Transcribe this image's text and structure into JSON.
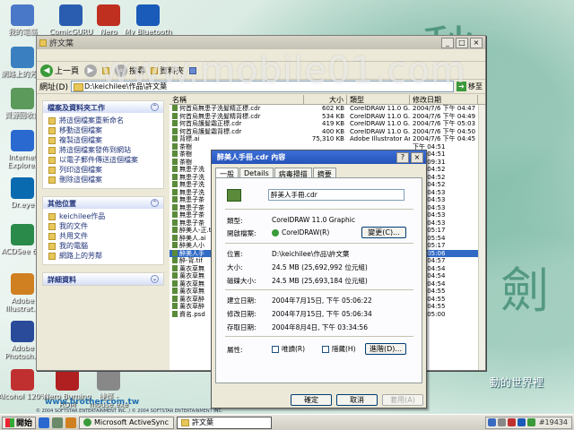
{
  "watermark": "www.mobile01.com",
  "banner": "www.brother.com.tw",
  "banner_small": "© 2004 SOFTSTAR ENTERTAINMENT INC. / © 2004 SOFTSTAR ENTERTAINMENT INC.",
  "slogan": "動的世界裡",
  "decor": {
    "glyph1": "愁",
    "glyph2": "劍"
  },
  "desktop_icons": [
    {
      "label": "我的電腦",
      "color": "#4a78c8"
    },
    {
      "label": "ComicGURU Converter",
      "color": "#2a5db0"
    },
    {
      "label": "Nero StartSmart",
      "color": "#c03020"
    },
    {
      "label": "My Bluetooth Places",
      "color": "#1a5ab8"
    },
    {
      "label": "網路上的芳鄰",
      "color": "#3a80c0"
    },
    {
      "label": "資源回收筒",
      "color": "#5b9a5b"
    },
    {
      "label": "Internet Explorer",
      "color": "#2a6ad0"
    },
    {
      "label": "Dr.eye",
      "color": "#0a6ab0"
    },
    {
      "label": "ACDSee 6.0",
      "color": "#2a8a4a"
    },
    {
      "label": "Adobe Illustrat...",
      "color": "#d08020"
    },
    {
      "label": "Adobe Photosh...",
      "color": "#2a4a9a"
    },
    {
      "label": "Alcohol 120%",
      "color": "#c03030"
    },
    {
      "label": "Nero Burning ROM",
      "color": "#b02020"
    },
    {
      "label": "捷徑 - mouse.exe",
      "color": "#888888"
    }
  ],
  "explorer": {
    "title": "許文葉",
    "toolbar": {
      "back": "上一頁",
      "search": "搜尋",
      "folders": "資料夾"
    },
    "address_label": "網址(D)",
    "address_value": "D:\\keichilee\\作品\\許文葉",
    "go_label": "移至",
    "panels": [
      {
        "title": "檔案及資料夾工作",
        "items": [
          "將這個檔案重新命名",
          "移動這個檔案",
          "複製這個檔案",
          "將這個檔案發佈到網站",
          "以電子郵件傳送這個檔案",
          "列印這個檔案",
          "刪除這個檔案"
        ]
      },
      {
        "title": "其他位置",
        "items": [
          "keichilee作品",
          "我的文件",
          "共用文件",
          "我的電腦",
          "網路上的芳鄰"
        ]
      },
      {
        "title": "詳細資料",
        "items": []
      }
    ],
    "columns": [
      "名稱",
      "大小",
      "類型",
      "修改日期"
    ],
    "files": [
      {
        "name": "何首烏無患子洗髮精正標.cdr",
        "size": "602 KB",
        "type": "CorelDRAW 11.0 G...",
        "date": "2004/7/6 下午 04:47"
      },
      {
        "name": "何首烏無患子洗髮精背標.cdr",
        "size": "534 KB",
        "type": "CorelDRAW 11.0 G...",
        "date": "2004/7/6 下午 04:49"
      },
      {
        "name": "何首烏護髮霜正標.cdr",
        "size": "419 KB",
        "type": "CorelDRAW 11.0 G...",
        "date": "2004/7/6 下午 05:03"
      },
      {
        "name": "何首烏護髮霜背標.cdr",
        "size": "400 KB",
        "type": "CorelDRAW 11.0 G...",
        "date": "2004/7/6 下午 04:50"
      },
      {
        "name": "背標.ai",
        "size": "75,310 KB",
        "type": "Adobe Illustrator Art...",
        "date": "2004/7/6 下午 04:45"
      },
      {
        "name": "茶樹",
        "size": "",
        "type": "",
        "date": "下午 04:51"
      },
      {
        "name": "茶樹",
        "size": "",
        "type": "",
        "date": "下午 04:51"
      },
      {
        "name": "茶樹",
        "size": "",
        "type": "",
        "date": "下午 09:31"
      },
      {
        "name": "無患子洗",
        "size": "",
        "type": "",
        "date": "下午 04:52"
      },
      {
        "name": "無患子洗",
        "size": "",
        "type": "",
        "date": "下午 04:52"
      },
      {
        "name": "無患子洗",
        "size": "",
        "type": "",
        "date": "下午 04:52"
      },
      {
        "name": "無患子洗",
        "size": "",
        "type": "",
        "date": "下午 04:53"
      },
      {
        "name": "無患子茶",
        "size": "",
        "type": "",
        "date": "下午 04:53"
      },
      {
        "name": "無患子茶",
        "size": "",
        "type": "",
        "date": "下午 04:53"
      },
      {
        "name": "無患子茶",
        "size": "",
        "type": "",
        "date": "下午 04:53"
      },
      {
        "name": "無患子茶",
        "size": "",
        "type": "",
        "date": "下午 04:53"
      },
      {
        "name": "醉美人-正.tif",
        "size": "",
        "type": "",
        "date": "下午 05:17"
      },
      {
        "name": "醉美人.ai",
        "size": "",
        "type": "",
        "date": "下午 05:54"
      },
      {
        "name": "醉美人小",
        "size": "",
        "type": "",
        "date": "下午 05:17"
      },
      {
        "name": "醉美人手",
        "size": "",
        "type": "",
        "date": "下午 05:06",
        "selected": true
      },
      {
        "name": "醉-背.tif",
        "size": "",
        "type": "",
        "date": "下午 04:57"
      },
      {
        "name": "薰衣草無",
        "size": "",
        "type": "",
        "date": "下午 04:54"
      },
      {
        "name": "薰衣草無",
        "size": "",
        "type": "",
        "date": "下午 04:54"
      },
      {
        "name": "薰衣草無",
        "size": "",
        "type": "",
        "date": "下午 04:54"
      },
      {
        "name": "薰衣草無",
        "size": "",
        "type": "",
        "date": "下午 04:55"
      },
      {
        "name": "薰衣草醉",
        "size": "",
        "type": "",
        "date": "下午 04:55"
      },
      {
        "name": "薰衣草醉",
        "size": "",
        "type": "",
        "date": "下午 04:55"
      },
      {
        "name": "資名.psd",
        "size": "",
        "type": "",
        "date": "下午 05:00"
      }
    ]
  },
  "props": {
    "title": "醉美人手冊.cdr 內容",
    "tabs": [
      "一般",
      "Details",
      "病毒掃描",
      "摘要"
    ],
    "filename": "醉美人手冊.cdr",
    "rows": {
      "type_label": "類型:",
      "type_value": "CorelDRAW 11.0 Graphic",
      "open_label": "開啟檔案:",
      "open_value": "CorelDRAW(R)",
      "change_btn": "變更(C)...",
      "loc_label": "位置:",
      "loc_value": "D:\\keichilee\\作品\\許文葉",
      "size_label": "大小:",
      "size_value": "24.5 MB (25,692,992 位元組)",
      "disk_label": "磁碟大小:",
      "disk_value": "24.5 MB (25,693,184 位元組)",
      "created_label": "建立日期:",
      "created_value": "2004年7月15日, 下午 05:06:22",
      "modified_label": "修改日期:",
      "modified_value": "2004年7月15日, 下午 05:06:34",
      "accessed_label": "存取日期:",
      "accessed_value": "2004年8月4日, 下午 03:34:56",
      "attr_label": "屬性:",
      "readonly": "唯讀(R)",
      "hidden": "隱藏(H)",
      "advanced_btn": "進階(D)..."
    },
    "buttons": {
      "ok": "確定",
      "cancel": "取消",
      "apply": "套用(A)"
    }
  },
  "taskbar": {
    "start": "開始",
    "tasks": [
      "Microsoft ActiveSync",
      "許文葉"
    ],
    "clock": "#19434"
  }
}
